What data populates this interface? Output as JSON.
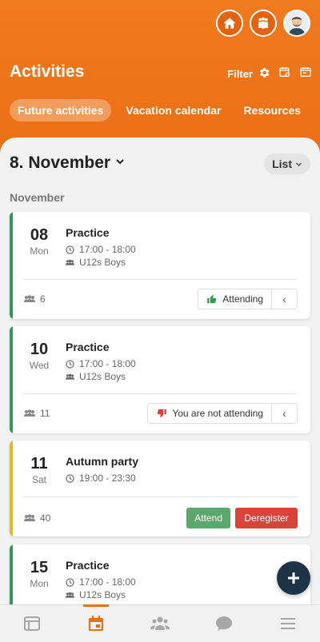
{
  "header": {
    "title": "Activities",
    "filter_label": "Filter",
    "icons": [
      "home-icon",
      "team-icon",
      "user-avatar",
      "filter-gear-icon",
      "calendar-sync-icon",
      "calendar-export-icon"
    ],
    "tabs": [
      {
        "label": "Future activities",
        "active": true
      },
      {
        "label": "Vacation calendar",
        "active": false
      },
      {
        "label": "Resources",
        "active": false
      }
    ]
  },
  "main": {
    "date_title": "8. November",
    "view_toggle": "List",
    "month_label": "November"
  },
  "activities": [
    {
      "day": "08",
      "weekday": "Mon",
      "title": "Practice",
      "time": "17:00 - 18:00",
      "group": "U12s Boys",
      "count": "6",
      "status": "Attending",
      "status_icon": "thumbs-up-icon",
      "bar_color": "#2e9c55"
    },
    {
      "day": "10",
      "weekday": "Wed",
      "title": "Practice",
      "time": "17:00 - 18:00",
      "group": "U12s Boys",
      "count": "11",
      "status": "You are not attending",
      "status_icon": "thumbs-down-icon",
      "bar_color": "#2e9c55"
    },
    {
      "day": "11",
      "weekday": "Sat",
      "title": "Autumn party",
      "time": "19:00 - 23:30",
      "count": "40",
      "attend_label": "Attend",
      "deregister_label": "Deregister",
      "bar_color": "#e8b91c"
    },
    {
      "day": "15",
      "weekday": "Mon",
      "title": "Practice",
      "time": "17:00 - 18:00",
      "group": "U12s Boys",
      "bar_color": "#2e9c55"
    }
  ],
  "colors": {
    "accent": "#ec6f14",
    "attend": "#5ba86d",
    "deregister": "#d9433a",
    "thumbs_up": "#2e9c55",
    "thumbs_down": "#d9433a",
    "fab": "#1d3447"
  },
  "bottom_nav": [
    {
      "icon": "news-icon",
      "active": false
    },
    {
      "icon": "calendar-icon",
      "active": true
    },
    {
      "icon": "members-icon",
      "active": false
    },
    {
      "icon": "chat-icon",
      "active": false
    },
    {
      "icon": "menu-icon",
      "active": false
    }
  ]
}
